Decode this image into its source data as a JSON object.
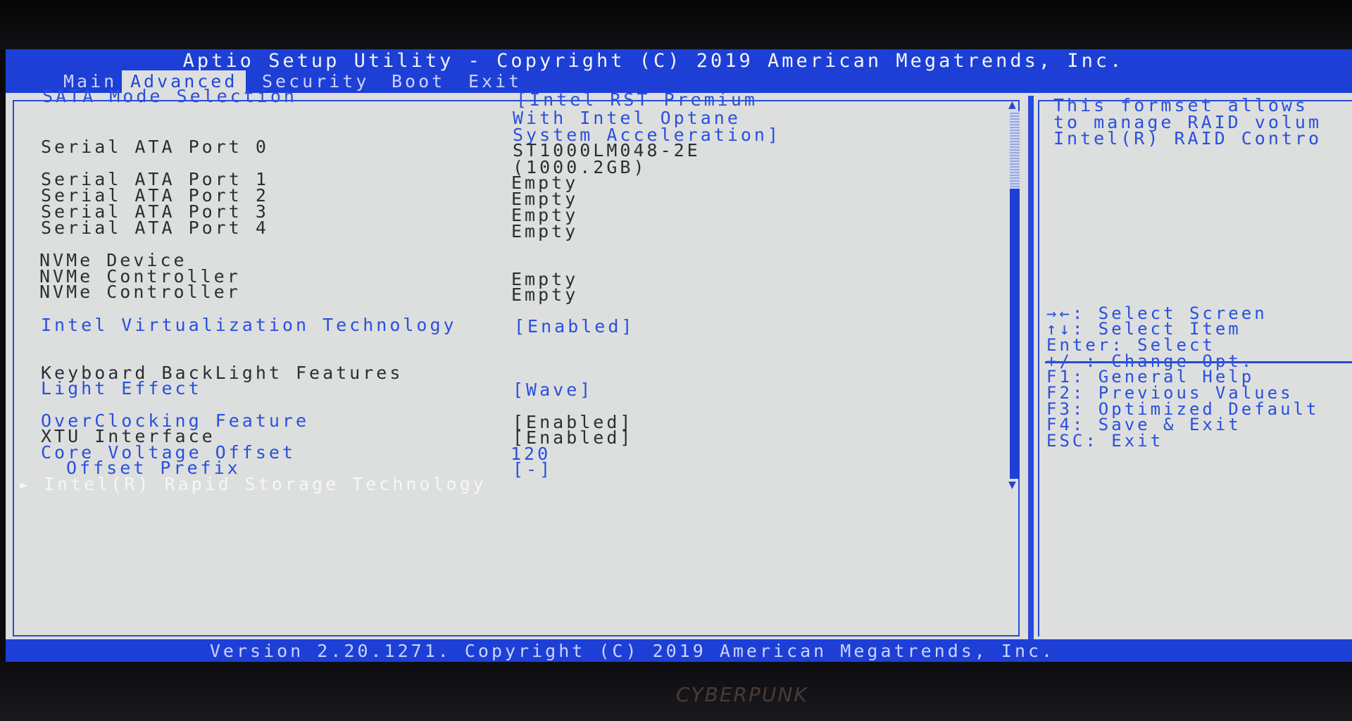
{
  "title": "Aptio Setup Utility - Copyright (C) 2019 American Megatrends, Inc.",
  "tabs": [
    {
      "label": "Main"
    },
    {
      "label": "Advanced"
    },
    {
      "label": "Security"
    },
    {
      "label": "Boot"
    },
    {
      "label": "Exit"
    }
  ],
  "settings": {
    "sata_mode": {
      "label": "SATA Mode Selection",
      "value_lines": [
        "[Intel RST Premium",
        "With Intel Optane",
        "System Acceleration]"
      ]
    },
    "sata_port0": {
      "label": "Serial ATA Port 0",
      "value_lines": [
        "ST1000LM048-2E",
        "(1000.2GB)"
      ]
    },
    "sata_port1": {
      "label": "Serial ATA Port 1",
      "value": "Empty"
    },
    "sata_port2": {
      "label": "Serial ATA Port 2",
      "value": "Empty"
    },
    "sata_port3": {
      "label": "Serial ATA Port 3",
      "value": "Empty"
    },
    "sata_port4": {
      "label": "Serial ATA Port 4",
      "value": "Empty"
    },
    "nvme_device": {
      "label": "NVMe Device"
    },
    "nvme_ctrl1": {
      "label": "NVMe Controller",
      "value": "Empty"
    },
    "nvme_ctrl2": {
      "label": "NVMe Controller",
      "value": "Empty"
    },
    "virtualization": {
      "label": "Intel Virtualization Technology",
      "value": "[Enabled]"
    },
    "kb_backlight": {
      "label": "Keyboard BackLight Features"
    },
    "light_effect": {
      "label": "Light Effect",
      "value": "[Wave]"
    },
    "overclocking": {
      "label": "OverClocking Feature",
      "value": "[Enabled]"
    },
    "xtu": {
      "label": "XTU Interface",
      "value": "[Enabled]"
    },
    "core_voltage": {
      "label": "Core Voltage Offset",
      "value": "120"
    },
    "offset_prefix": {
      "label": "Offset Prefix",
      "value": "[-]"
    },
    "rst": {
      "label": "Intel(R) Rapid Storage Technology",
      "arrow": "►"
    }
  },
  "help": {
    "lines": [
      "This formset allows",
      "to manage RAID volum",
      "Intel(R) RAID Contro"
    ]
  },
  "keys": [
    "→←: Select Screen",
    "↑↓: Select Item",
    "Enter: Select",
    "+/-: Change Opt.",
    "F1: General Help",
    "F2: Previous Values",
    "F3: Optimized Default",
    "F4: Save & Exit",
    "ESC: Exit"
  ],
  "scrollbar": {
    "up": "▲",
    "down": "▼"
  },
  "footer": "Version 2.20.1271. Copyright (C) 2019 American Megatrends, Inc.",
  "brand": "CYBERPUNK",
  "colors": {
    "bios_blue": "#1d3fd6",
    "bios_grey": "#dcdfdd",
    "label_blue": "#2a4fe0"
  }
}
